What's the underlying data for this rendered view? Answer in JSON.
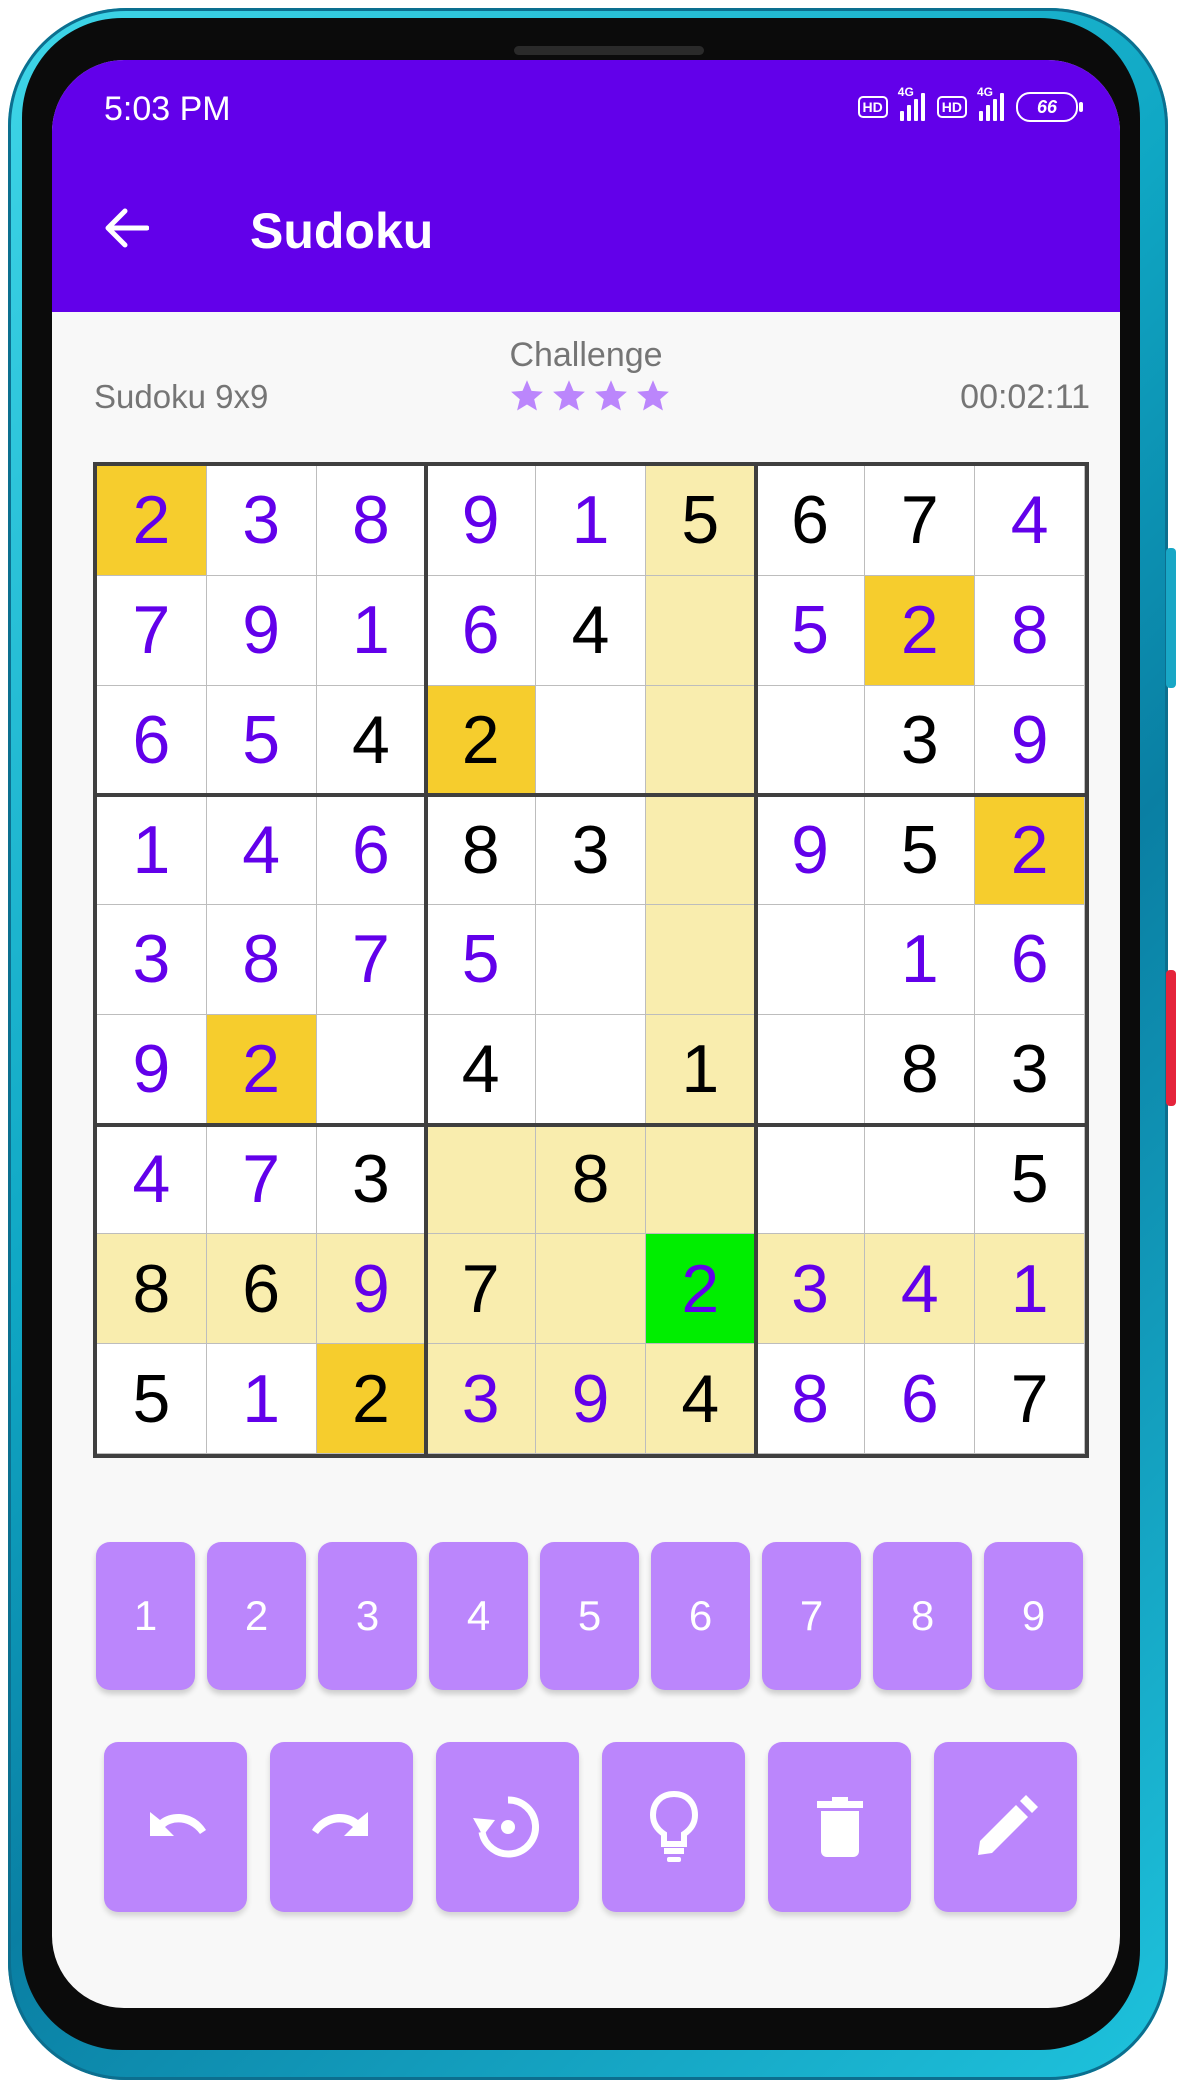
{
  "status_bar": {
    "time": "5:03 PM",
    "hd_label": "HD",
    "network_label": "4G",
    "battery_level": "66"
  },
  "app_bar": {
    "title": "Sudoku",
    "back_icon": "arrow-left-icon"
  },
  "info": {
    "game_type": "Sudoku 9x9",
    "difficulty": "Challenge",
    "difficulty_stars": 4,
    "timer": "00:02:11"
  },
  "colors": {
    "app_bar": "#6200ea",
    "accent_key": "#bb86fc",
    "entered_digit": "#6200ea",
    "given_digit": "#000000",
    "highlight_row_col": "#f9edae",
    "same_number": "#f6cd2d",
    "selected_cell": "#00ee00",
    "star": "#bb86fc"
  },
  "board": {
    "selected": [
      7,
      5
    ],
    "rows": [
      [
        {
          "v": "2",
          "t": "e",
          "s": "same"
        },
        {
          "v": "3",
          "t": "e"
        },
        {
          "v": "8",
          "t": "e"
        },
        {
          "v": "9",
          "t": "e"
        },
        {
          "v": "1",
          "t": "e"
        },
        {
          "v": "5",
          "t": "g",
          "s": "hl"
        },
        {
          "v": "6",
          "t": "g"
        },
        {
          "v": "7",
          "t": "g"
        },
        {
          "v": "4",
          "t": "e"
        }
      ],
      [
        {
          "v": "7",
          "t": "e"
        },
        {
          "v": "9",
          "t": "e"
        },
        {
          "v": "1",
          "t": "e"
        },
        {
          "v": "6",
          "t": "e"
        },
        {
          "v": "4",
          "t": "g"
        },
        {
          "v": "",
          "t": "g",
          "s": "hl"
        },
        {
          "v": "5",
          "t": "e"
        },
        {
          "v": "2",
          "t": "e",
          "s": "same"
        },
        {
          "v": "8",
          "t": "e"
        }
      ],
      [
        {
          "v": "6",
          "t": "e"
        },
        {
          "v": "5",
          "t": "e"
        },
        {
          "v": "4",
          "t": "g"
        },
        {
          "v": "2",
          "t": "g",
          "s": "same"
        },
        {
          "v": "",
          "t": "g"
        },
        {
          "v": "",
          "t": "g",
          "s": "hl"
        },
        {
          "v": "",
          "t": "g"
        },
        {
          "v": "3",
          "t": "g"
        },
        {
          "v": "9",
          "t": "e"
        }
      ],
      [
        {
          "v": "1",
          "t": "e"
        },
        {
          "v": "4",
          "t": "e"
        },
        {
          "v": "6",
          "t": "e"
        },
        {
          "v": "8",
          "t": "g"
        },
        {
          "v": "3",
          "t": "g"
        },
        {
          "v": "",
          "t": "g",
          "s": "hl"
        },
        {
          "v": "9",
          "t": "e"
        },
        {
          "v": "5",
          "t": "g"
        },
        {
          "v": "2",
          "t": "e",
          "s": "same"
        }
      ],
      [
        {
          "v": "3",
          "t": "e"
        },
        {
          "v": "8",
          "t": "e"
        },
        {
          "v": "7",
          "t": "e"
        },
        {
          "v": "5",
          "t": "e"
        },
        {
          "v": "",
          "t": "g"
        },
        {
          "v": "",
          "t": "g",
          "s": "hl"
        },
        {
          "v": "",
          "t": "g"
        },
        {
          "v": "1",
          "t": "e"
        },
        {
          "v": "6",
          "t": "e"
        }
      ],
      [
        {
          "v": "9",
          "t": "e"
        },
        {
          "v": "2",
          "t": "e",
          "s": "same"
        },
        {
          "v": "",
          "t": "g"
        },
        {
          "v": "4",
          "t": "g"
        },
        {
          "v": "",
          "t": "g"
        },
        {
          "v": "1",
          "t": "g",
          "s": "hl"
        },
        {
          "v": "",
          "t": "g"
        },
        {
          "v": "8",
          "t": "g"
        },
        {
          "v": "3",
          "t": "g"
        }
      ],
      [
        {
          "v": "4",
          "t": "e"
        },
        {
          "v": "7",
          "t": "e"
        },
        {
          "v": "3",
          "t": "g"
        },
        {
          "v": "",
          "t": "g",
          "s": "hl"
        },
        {
          "v": "8",
          "t": "g",
          "s": "hl"
        },
        {
          "v": "",
          "t": "g",
          "s": "hl"
        },
        {
          "v": "",
          "t": "g"
        },
        {
          "v": "",
          "t": "g"
        },
        {
          "v": "5",
          "t": "g"
        }
      ],
      [
        {
          "v": "8",
          "t": "g",
          "s": "hl"
        },
        {
          "v": "6",
          "t": "g",
          "s": "hl"
        },
        {
          "v": "9",
          "t": "e",
          "s": "hl"
        },
        {
          "v": "7",
          "t": "g",
          "s": "hl"
        },
        {
          "v": "",
          "t": "g",
          "s": "hl"
        },
        {
          "v": "2",
          "t": "e",
          "s": "sel"
        },
        {
          "v": "3",
          "t": "e",
          "s": "hl"
        },
        {
          "v": "4",
          "t": "e",
          "s": "hl"
        },
        {
          "v": "1",
          "t": "e",
          "s": "hl"
        }
      ],
      [
        {
          "v": "5",
          "t": "g"
        },
        {
          "v": "1",
          "t": "e"
        },
        {
          "v": "2",
          "t": "g",
          "s": "same"
        },
        {
          "v": "3",
          "t": "e",
          "s": "hl"
        },
        {
          "v": "9",
          "t": "e",
          "s": "hl"
        },
        {
          "v": "4",
          "t": "g",
          "s": "hl"
        },
        {
          "v": "8",
          "t": "e"
        },
        {
          "v": "6",
          "t": "e"
        },
        {
          "v": "7",
          "t": "g"
        }
      ]
    ]
  },
  "number_pad": [
    "1",
    "2",
    "3",
    "4",
    "5",
    "6",
    "7",
    "8",
    "9"
  ],
  "tools": [
    {
      "name": "undo-button",
      "icon": "undo-icon"
    },
    {
      "name": "redo-button",
      "icon": "redo-icon"
    },
    {
      "name": "restart-button",
      "icon": "restart-icon"
    },
    {
      "name": "hint-button",
      "icon": "lightbulb-icon"
    },
    {
      "name": "erase-button",
      "icon": "trash-icon"
    },
    {
      "name": "notes-button",
      "icon": "pencil-icon"
    }
  ]
}
